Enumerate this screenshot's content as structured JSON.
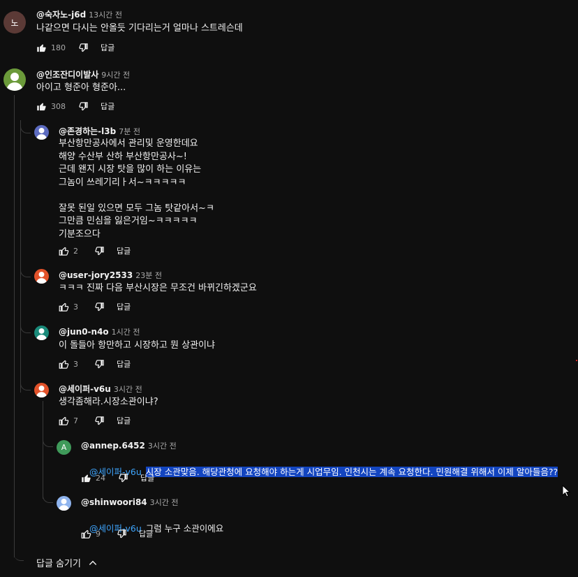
{
  "comments": [
    {
      "author": "@숙자노-j6d",
      "time": "13시간 전",
      "lines": [
        "나같으면 다시는 안올듯 기다리는거 얼마나 스트레슨데"
      ],
      "likes": "180",
      "reply_label": "답글",
      "avatar": {
        "letter": "노",
        "color": "#5b3a36"
      }
    },
    {
      "author": "@인조잔디이발사",
      "time": "9시간 전",
      "lines": [
        "아이고 형준아 형준아..."
      ],
      "likes": "308",
      "reply_label": "답글",
      "avatar": {
        "color": "#6b9a3a"
      }
    }
  ],
  "replies": [
    {
      "author": "@존경하는-l3b",
      "time": "7분 전",
      "lines": [
        "부산항만공사에서 관리및 운영한데요",
        "해양 수산부 산하 부산항만공사~!",
        "근데 왠지 시장 탓을 많이 하는 이유는",
        "그놈이 쓰레기리ㅏ서~ㅋㅋㅋㅋㅋ",
        "",
        "잘못 된일 있으면 모두 그놈 탓같아서~ㅋ",
        "그만큼 민심을 잃은거임~ㅋㅋㅋㅋㅋ",
        "기분조으다"
      ],
      "likes": "2",
      "reply_label": "답글",
      "avatar": {
        "color": "#5c6bc0"
      }
    },
    {
      "author": "@user-jory2533",
      "time": "23분 전",
      "lines": [
        "ㅋㅋㅋ 진짜 다음 부산시장은 무조건 바뀌긴하겠군요"
      ],
      "likes": "3",
      "reply_label": "답글",
      "avatar": {
        "color": "#e2522a"
      }
    },
    {
      "author": "@jun0-n4o",
      "time": "1시간 전",
      "lines": [
        "이 돌들아 항만하고 시장하고 뭔 상관이냐"
      ],
      "likes": "3",
      "reply_label": "답글",
      "avatar": {
        "color": "#1a8a7a"
      }
    },
    {
      "author": "@세이퍼-v6u",
      "time": "3시간 전",
      "lines": [
        "생각좀해라.시장소관이냐?"
      ],
      "likes": "7",
      "reply_label": "답글",
      "avatar": {
        "color": "#e2522a"
      }
    }
  ],
  "subreplies": [
    {
      "author": "@annep.6452",
      "time": "3시간 전",
      "mention": "@세이퍼-v6u",
      "text": "시장 소관맞음. 해당관청에 요청해야 하는게 시업무임. 인천시는 계속 요청한다. 민원해결 위해서 이제 알아들음??",
      "likes": "24",
      "reply_label": "답글",
      "avatar": {
        "letter": "A",
        "color": "#3f9a5a"
      }
    },
    {
      "author": "@shinwoori84",
      "time": "3시간 전",
      "mention": "@세이퍼-v6u",
      "text": "그럼 누구 소관이에요",
      "likes": "9",
      "reply_label": "답글",
      "avatar": {
        "color": "#8fb4ee"
      }
    }
  ],
  "hide_replies_label": "답글 숨기기"
}
